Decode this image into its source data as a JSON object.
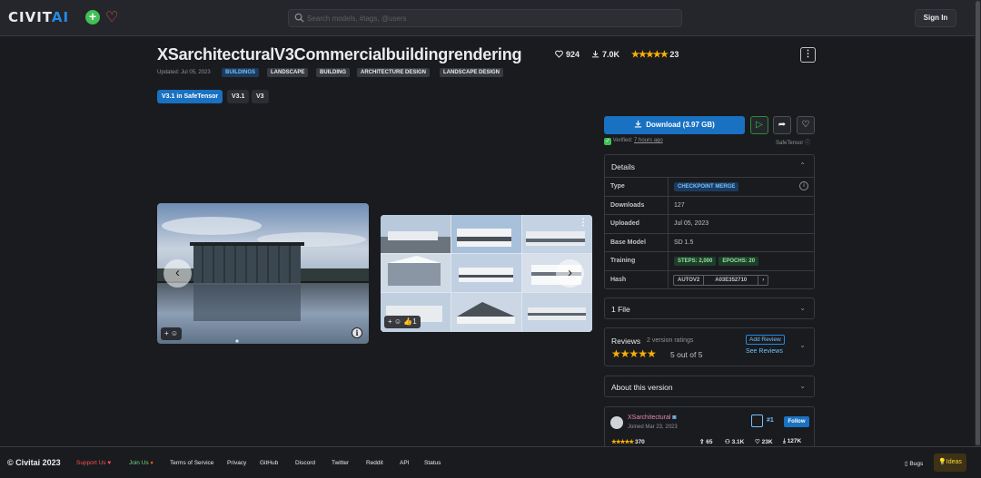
{
  "header": {
    "logo_civit": "CIVIT",
    "logo_ai": "AI",
    "search_placeholder": "Search models, #tags, @users",
    "signin_label": "Sign In"
  },
  "model": {
    "title": "XSarchitecturalV3Commercialbuildingrendering",
    "likes": "924",
    "downloads": "7.0K",
    "rating_count": "23",
    "updated": "Updated: Jul 05, 2023",
    "tags": [
      "BUILDINGS",
      "LANDSCAPE",
      "BUILDING",
      "ARCHITECTURE DESIGN",
      "LANDSCAPE DESIGN"
    ],
    "versions": [
      "V3.1 in SafeTensor",
      "V3.1",
      "V3"
    ]
  },
  "gallery": {
    "card1_reaction": "+ ☺",
    "card2_reaction": "+ ☺",
    "card2_like_count": "1"
  },
  "sidebar": {
    "download_label": "Download (3.97 GB)",
    "verified_label": "Verified:",
    "verified_time": "7 hours ago",
    "format_label": "SafeTensor",
    "details_title": "Details",
    "details": {
      "type_label": "Type",
      "type_value": "CHECKPOINT MERGE",
      "downloads_label": "Downloads",
      "downloads_value": "127",
      "uploaded_label": "Uploaded",
      "uploaded_value": "Jul 05, 2023",
      "base_model_label": "Base Model",
      "base_model_value": "SD 1.5",
      "training_label": "Training",
      "steps_value": "STEPS: 2,000",
      "epochs_value": "EPOCHS: 20",
      "hash_label": "Hash",
      "hash_type": "AUTOV2",
      "hash_value": "A03E352710"
    },
    "files_title": "1 File",
    "reviews_title": "Reviews",
    "reviews_subtitle": "2 version ratings",
    "reviews_score": "5 out of 5",
    "add_review_label": "Add Review",
    "see_reviews_label": "See Reviews",
    "about_title": "About this version",
    "author": {
      "name": "XSarchitectural",
      "joined": "Joined Mar 23, 2023",
      "rank": "#1",
      "follow_label": "Follow",
      "rating_count": "370",
      "uploads": "65",
      "followers": "3.1K",
      "likes": "23K",
      "downloads": "127K"
    }
  },
  "footer": {
    "copyright": "© Civitai 2023",
    "support": "Support Us",
    "join": "Join Us",
    "links": [
      "Terms of Service",
      "Privacy",
      "GitHub",
      "Discord",
      "Twitter",
      "Reddit",
      "API",
      "Status"
    ],
    "bugs": "Bugs",
    "ideas": "Ideas"
  },
  "colors": {
    "accent": "#1971c2",
    "star": "#fab005",
    "background": "#1a1b1e"
  }
}
